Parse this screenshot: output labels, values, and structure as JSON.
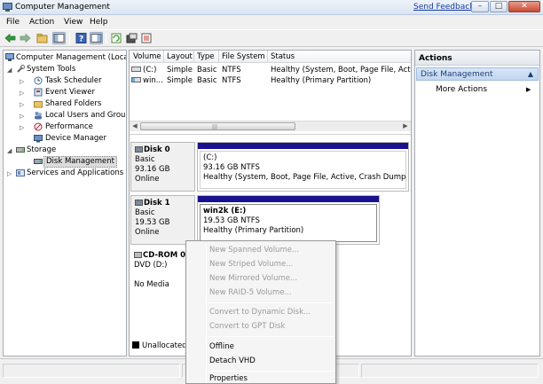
{
  "window": {
    "title": "Computer Management",
    "feedback_link": "Send Feedback",
    "min_glyph": "–",
    "max_glyph": "□",
    "close_glyph": "✕"
  },
  "menubar": [
    "File",
    "Action",
    "View",
    "Help"
  ],
  "tree": {
    "items": [
      {
        "label": "Computer Management (Local",
        "icon": "computer-management-icon"
      },
      {
        "label": "System Tools",
        "icon": "tools-icon"
      },
      {
        "label": "Task Scheduler",
        "icon": "clock-icon"
      },
      {
        "label": "Event Viewer",
        "icon": "event-viewer-icon"
      },
      {
        "label": "Shared Folders",
        "icon": "shared-folder-icon"
      },
      {
        "label": "Local Users and Groups",
        "icon": "users-icon"
      },
      {
        "label": "Performance",
        "icon": "performance-icon"
      },
      {
        "label": "Device Manager",
        "icon": "device-manager-icon"
      },
      {
        "label": "Storage",
        "icon": "storage-icon"
      },
      {
        "label": "Disk Management",
        "icon": "disk-management-icon"
      },
      {
        "label": "Services and Applications",
        "icon": "services-icon"
      }
    ]
  },
  "volumes": {
    "columns": [
      "Volume",
      "Layout",
      "Type",
      "File System",
      "Status"
    ],
    "rows": [
      {
        "volume": "(C:)",
        "layout": "Simple",
        "type": "Basic",
        "fs": "NTFS",
        "status": "Healthy (System, Boot, Page File, Active,"
      },
      {
        "volume": "win...",
        "layout": "Simple",
        "type": "Basic",
        "fs": "NTFS",
        "status": "Healthy (Primary Partition)"
      }
    ],
    "scroll_grip": "|||"
  },
  "disks": [
    {
      "name": "Disk 0",
      "type": "Basic",
      "size": "93.16 GB",
      "state": "Online",
      "partition": {
        "name": "(C:)",
        "size": "93.16 GB NTFS",
        "status": "Healthy (System, Boot, Page File, Active, Crash Dump, Prim"
      }
    },
    {
      "name": "Disk 1",
      "type": "Basic",
      "size": "19.53 GB",
      "state": "Online",
      "partition": {
        "name": "win2k  (E:)",
        "size": "19.53 GB NTFS",
        "status": "Healthy (Primary Partition)"
      }
    },
    {
      "name": "CD-ROM 0",
      "type": "DVD (D:)",
      "state": "No Media"
    }
  ],
  "legend": {
    "unallocated": "Unallocated"
  },
  "actions": {
    "header": "Actions",
    "section": "Disk Management",
    "more": "More Actions"
  },
  "context_menu": {
    "items": [
      {
        "label": "New Spanned Volume...",
        "enabled": false
      },
      {
        "label": "New Striped Volume...",
        "enabled": false
      },
      {
        "label": "New Mirrored Volume...",
        "enabled": false
      },
      {
        "label": "New RAID-5 Volume...",
        "enabled": false
      },
      {
        "label": "Convert to Dynamic Disk...",
        "enabled": false
      },
      {
        "label": "Convert to GPT Disk",
        "enabled": false
      },
      {
        "label": "Offline",
        "enabled": true
      },
      {
        "label": "Detach VHD",
        "enabled": true
      },
      {
        "label": "Properties",
        "enabled": true
      }
    ]
  },
  "colors": {
    "partition_bar": "#19128e",
    "selection_blue": "#c1d6ef"
  }
}
